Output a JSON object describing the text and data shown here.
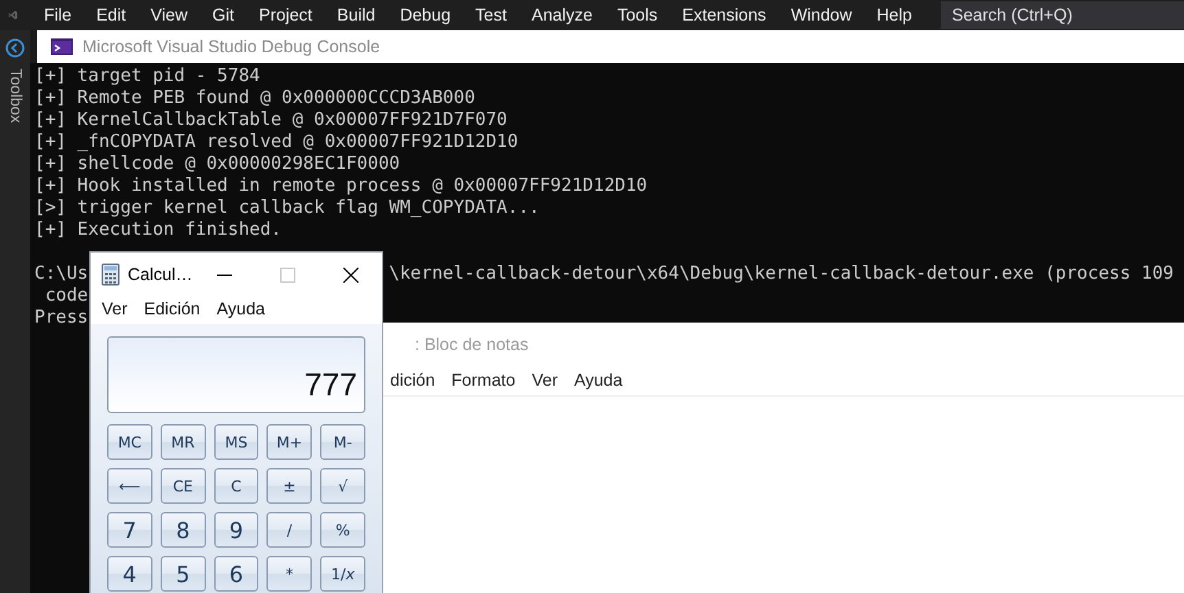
{
  "menubar": {
    "items": [
      "File",
      "Edit",
      "View",
      "Git",
      "Project",
      "Build",
      "Debug",
      "Test",
      "Analyze",
      "Tools",
      "Extensions",
      "Window",
      "Help"
    ],
    "search": {
      "placeholder": "Search (Ctrl+Q)"
    }
  },
  "side_panel": {
    "label": "Toolbox"
  },
  "console": {
    "title": "Microsoft Visual Studio Debug Console",
    "lines": [
      {
        "kind": "full",
        "text": "[+] target pid - 5784"
      },
      {
        "kind": "full",
        "text": "[+] Remote PEB found @ 0x000000CCCD3AB000"
      },
      {
        "kind": "full",
        "text": "[+] KernelCallbackTable @ 0x00007FF921D7F070"
      },
      {
        "kind": "full",
        "text": "[+] _fnCOPYDATA resolved @ 0x00007FF921D12D10"
      },
      {
        "kind": "full",
        "text": "[+] shellcode @ 0x00000298EC1F0000"
      },
      {
        "kind": "full",
        "text": "[+] Hook installed in remote process @ 0x00007FF921D12D10"
      },
      {
        "kind": "full",
        "text": "[>] trigger kernel callback flag WM_COPYDATA..."
      },
      {
        "kind": "full",
        "text": "[+] Execution finished."
      },
      {
        "kind": "blank"
      },
      {
        "kind": "split",
        "left": "C:\\Us",
        "right": "\\kernel-callback-detour\\x64\\Debug\\kernel-callback-detour.exe (process 109"
      },
      {
        "kind": "full",
        "text": " code"
      },
      {
        "kind": "full",
        "text": "Press"
      }
    ]
  },
  "calculator": {
    "title": "Calcul…",
    "menu": [
      "Ver",
      "Edición",
      "Ayuda"
    ],
    "display": "777",
    "keys": [
      [
        "MC",
        "MR",
        "MS",
        "M+",
        "M-"
      ],
      [
        "⟵",
        "CE",
        "C",
        "±",
        "√"
      ],
      [
        "7",
        "8",
        "9",
        "/",
        "%"
      ],
      [
        "4",
        "5",
        "6",
        "*",
        "1/*x*"
      ]
    ]
  },
  "notepad": {
    "title": ": Bloc de notas",
    "menu": [
      "dición",
      "Formato",
      "Ver",
      "Ayuda"
    ]
  }
}
